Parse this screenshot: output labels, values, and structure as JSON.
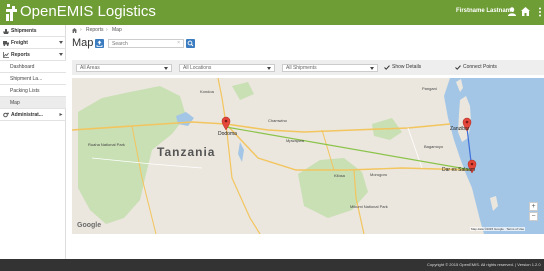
{
  "app": {
    "title": "OpenEMIS Logistics",
    "brand_color": "#6e9d36",
    "accent_color": "#3b7bbf"
  },
  "header": {
    "user_name": "Firstname Lastname",
    "icons": [
      "user-icon",
      "home-icon",
      "more-vertical-icon"
    ]
  },
  "sidebar": {
    "items": [
      {
        "label": "Shipments",
        "icon": "ship-icon"
      },
      {
        "label": "Freight",
        "icon": "truck-icon"
      },
      {
        "label": "Reports",
        "icon": "chart-icon"
      },
      {
        "label": "Administrat...",
        "icon": "cogs-icon"
      }
    ],
    "sub_items": [
      {
        "label": "Dashboard"
      },
      {
        "label": "Shipment La..."
      },
      {
        "label": "Packing Lists"
      },
      {
        "label": "Map",
        "active": true
      }
    ]
  },
  "breadcrumb": {
    "sep": "›",
    "items": [
      "Reports",
      "Map"
    ]
  },
  "page": {
    "title": "Map"
  },
  "search": {
    "placeholder": "Search",
    "clear": "×"
  },
  "filters": {
    "areas": "All Areas",
    "locations": "All Locations",
    "shipments": "All Shipments",
    "show_details": "Show Details",
    "connect_points": "Connect Points"
  },
  "map": {
    "country_label": "Tanzania",
    "cities": {
      "dodoma": "Dodoma",
      "zanzibar": "Zanzibar",
      "dar": "Dar es Salaam",
      "morogoro": "Morogoro",
      "kilosa": "Kilosa",
      "mpwapwa": "Mpwapwa",
      "kondoa": "Kondoa",
      "ruaha": "Ruaha National Park",
      "mikumi": "Mikumi National Park",
      "pangani": "Pangani",
      "bagamoyo": "Bagamoyo",
      "chamwino": "Chamwino"
    },
    "zoom_in": "+",
    "zoom_out": "−",
    "google": "Google",
    "attribution": "Map data ©2015 Google · Terms of Use"
  },
  "footer": {
    "text": "Copyright © 2015 OpenEMIS. All rights reserved. | Version 1.2.0"
  }
}
